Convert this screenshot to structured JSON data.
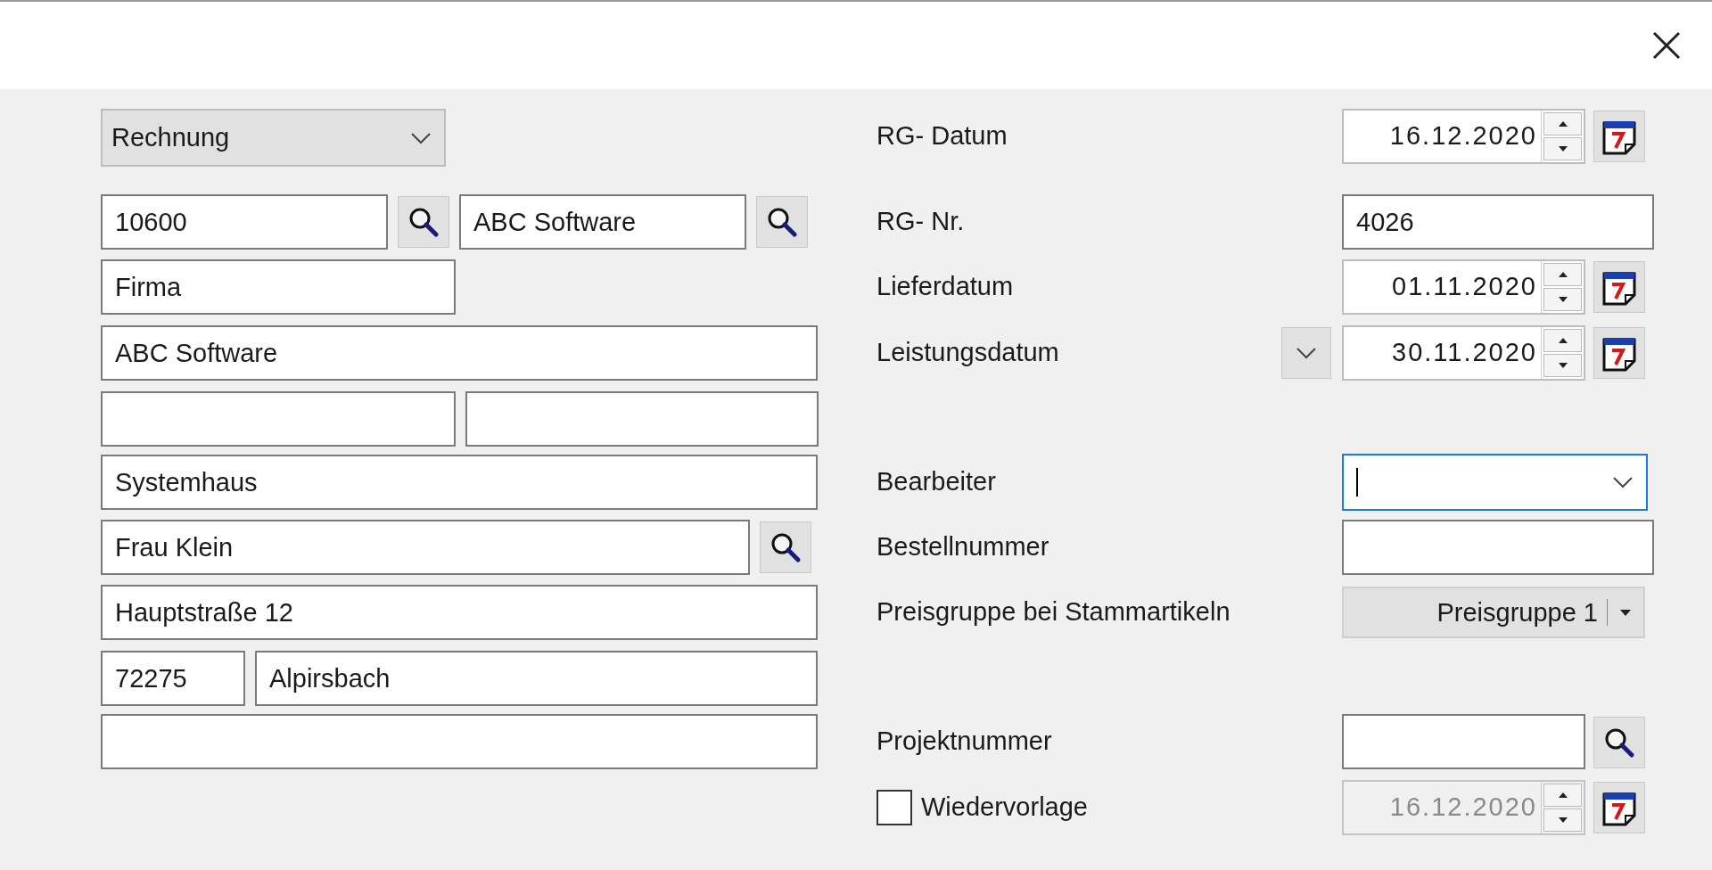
{
  "document_type": {
    "value": "Rechnung"
  },
  "address_rows": [
    [
      {
        "value": "10600",
        "search": true
      },
      {
        "value": "ABC Software",
        "search": true
      }
    ],
    [
      {
        "value": "Firma",
        "search": false
      }
    ],
    [
      {
        "value": "ABC Software",
        "search": false
      }
    ],
    [
      {
        "search": false
      },
      {
        "search": false
      }
    ],
    [
      {
        "value": "Systemhaus",
        "search": false
      }
    ],
    [
      {
        "value": "Frau Klein",
        "search": true
      }
    ],
    [
      {
        "value": "Hauptstraße 12",
        "search": false
      }
    ],
    [
      {
        "value": "72275",
        "search": false
      },
      {
        "value": "Alpirsbach",
        "search": false
      }
    ],
    [
      {
        "search": false
      }
    ]
  ],
  "fields": [
    {
      "kind": "date",
      "label": "RG- Datum",
      "value": "16.12.2020",
      "disabled": false
    },
    {
      "kind": "text",
      "label": "RG- Nr.",
      "value": "4026"
    },
    {
      "kind": "date",
      "label": "Lieferdatum",
      "value": "01.11.2020",
      "disabled": false
    },
    {
      "kind": "date",
      "label": "Leistungsdatum",
      "value": "30.11.2020",
      "disabled": false,
      "toggle": true
    },
    {
      "kind": "combo",
      "label": "Bearbeiter",
      "focused": true
    },
    {
      "kind": "text",
      "label": "Bestellnummer"
    },
    {
      "kind": "select",
      "label": "Preisgruppe bei Stammartikeln",
      "value": "Preisgruppe 1"
    },
    {
      "kind": "search",
      "label": "Projektnummer"
    },
    {
      "kind": "checkbox_date",
      "label": "Wiedervorlage",
      "checked": false,
      "value": "16.12.2020",
      "disabled": true
    }
  ]
}
